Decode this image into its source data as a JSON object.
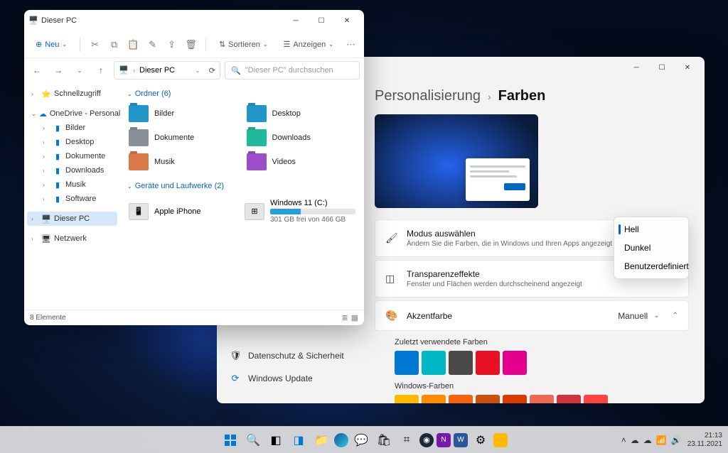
{
  "explorer": {
    "title": "Dieser PC",
    "toolbar": {
      "new": "Neu",
      "sort": "Sortieren",
      "view": "Anzeigen"
    },
    "address": "Dieser PC",
    "search_placeholder": "\"Dieser PC\" durchsuchen",
    "nav": {
      "quick": "Schnellzugriff",
      "onedrive": "OneDrive - Personal",
      "bilder": "Bilder",
      "desktop": "Desktop",
      "dokumente": "Dokumente",
      "downloads": "Downloads",
      "musik": "Musik",
      "software": "Software",
      "thispc": "Dieser PC",
      "netzwerk": "Netzwerk"
    },
    "groups": {
      "folders_header": "Ordner (6)",
      "drives_header": "Geräte und Laufwerke (2)"
    },
    "folders": {
      "bilder": "Bilder",
      "desktop": "Desktop",
      "dokumente": "Dokumente",
      "downloads": "Downloads",
      "musik": "Musik",
      "videos": "Videos"
    },
    "devices": {
      "iphone": "Apple iPhone",
      "drive_name": "Windows 11 (C:)",
      "drive_free": "301 GB frei von 466 GB"
    },
    "status": "8 Elemente"
  },
  "settings": {
    "breadcrumb_parent": "Personalisierung",
    "breadcrumb_current": "Farben",
    "nav": {
      "privacy": "Datenschutz & Sicherheit",
      "update": "Windows Update"
    },
    "rows": {
      "mode_title": "Modus auswählen",
      "mode_sub": "Ändern Sie die Farben, die in Windows und Ihren Apps angezeigt werden",
      "transparency_title": "Transparenzeffekte",
      "transparency_sub": "Fenster und Flächen werden durchscheinend angezeigt",
      "accent_title": "Akzentfarbe",
      "accent_value": "Manuell"
    },
    "dropdown": {
      "hell": "Hell",
      "dunkel": "Dunkel",
      "custom": "Benutzerdefiniert"
    },
    "sections": {
      "recent": "Zuletzt verwendete Farben",
      "windows": "Windows-Farben"
    },
    "recent_colors": [
      "#0078d4",
      "#00b7c3",
      "#4c4a48",
      "#e81123",
      "#e3008c"
    ],
    "windows_colors": [
      "#ffb900",
      "#ff8c00",
      "#f7630c",
      "#ca5010",
      "#da3b01",
      "#ef6950",
      "#d13438",
      "#ff4343"
    ]
  },
  "taskbar": {
    "time": "21:13",
    "date": "23.11.2021"
  }
}
